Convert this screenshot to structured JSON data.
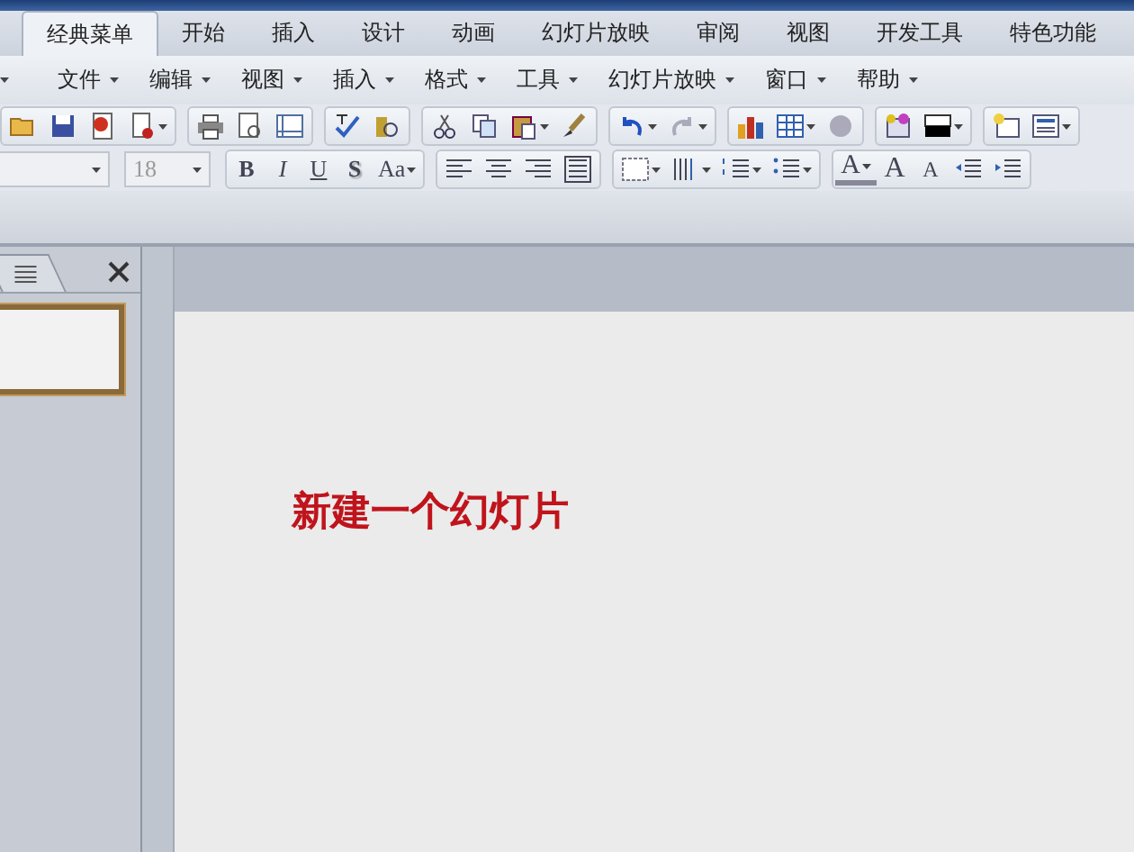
{
  "ribbon_tabs": [
    {
      "label": "经典菜单",
      "selected": true
    },
    {
      "label": "开始",
      "selected": false
    },
    {
      "label": "插入",
      "selected": false
    },
    {
      "label": "设计",
      "selected": false
    },
    {
      "label": "动画",
      "selected": false
    },
    {
      "label": "幻灯片放映",
      "selected": false
    },
    {
      "label": "审阅",
      "selected": false
    },
    {
      "label": "视图",
      "selected": false
    },
    {
      "label": "开发工具",
      "selected": false
    },
    {
      "label": "特色功能",
      "selected": false
    }
  ],
  "menu_bar": [
    "文件",
    "编辑",
    "视图",
    "插入",
    "格式",
    "工具",
    "幻灯片放映",
    "窗口",
    "帮助"
  ],
  "format_toolbar": {
    "font_size": "18",
    "style_buttons": [
      "B",
      "I",
      "U",
      "S",
      "Aa"
    ],
    "font_color_label": "A",
    "grow_label": "A",
    "shrink_label": "A"
  },
  "slide": {
    "text": "新建一个幻灯片"
  }
}
